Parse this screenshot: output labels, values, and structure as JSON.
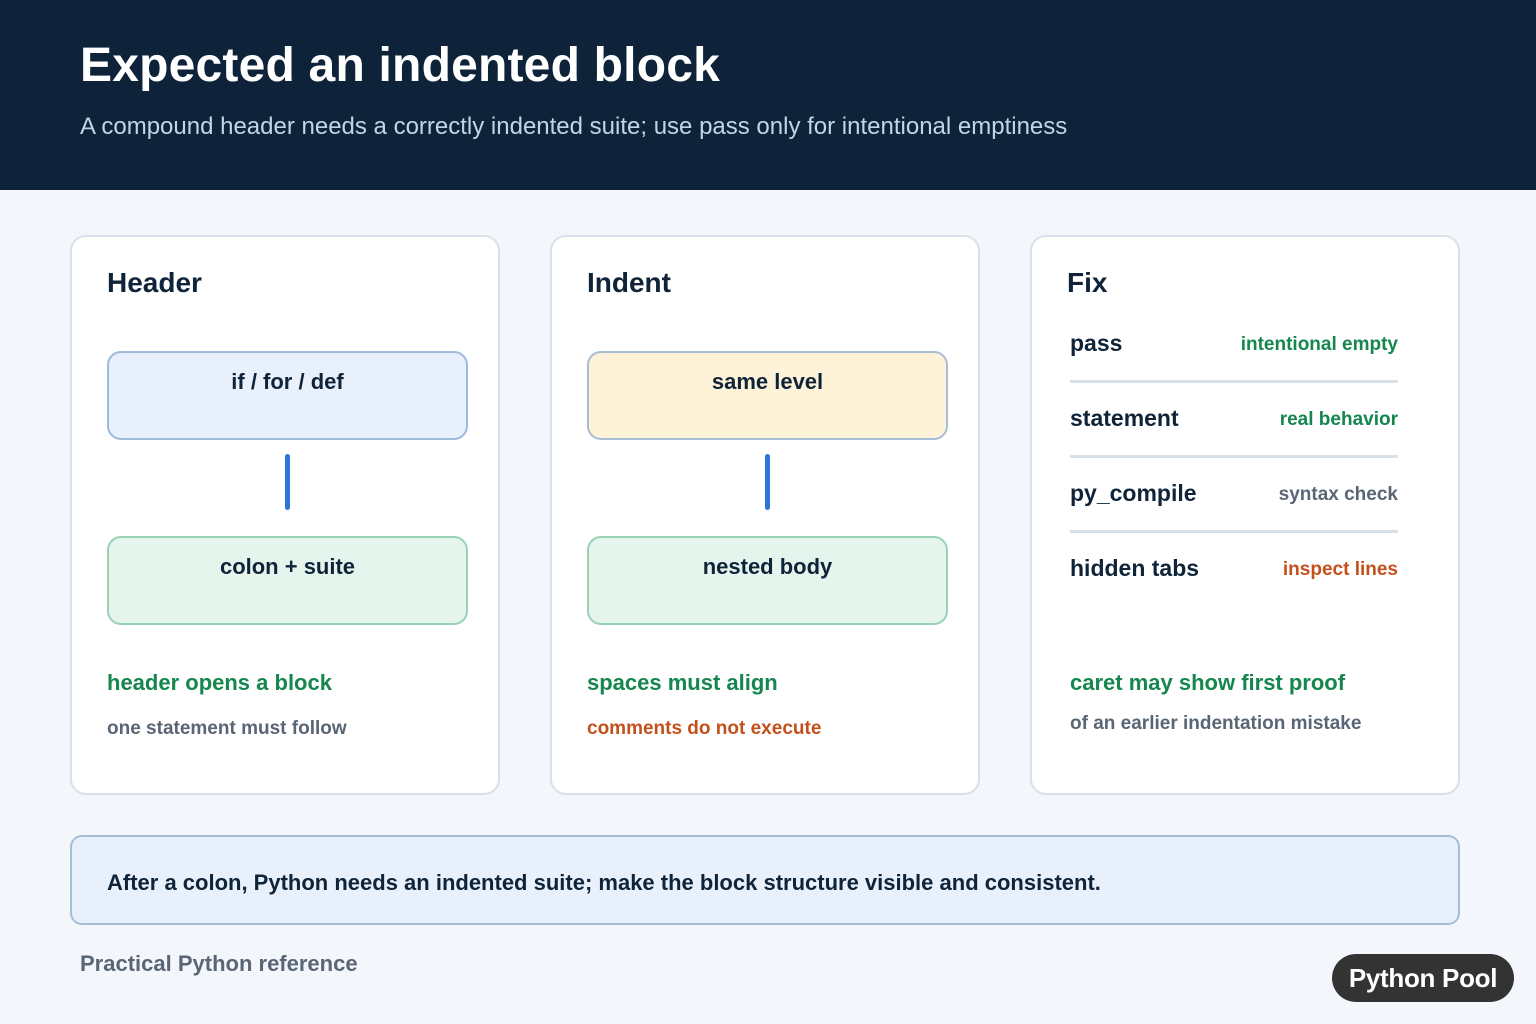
{
  "header": {
    "title": "Expected an indented block",
    "subtitle": "A compound header needs a correctly indented suite; use pass only for intentional emptiness"
  },
  "cards": {
    "header": {
      "title": "Header",
      "top_node": "if / for / def",
      "bottom_node": "colon + suite",
      "note_main": "header opens a block",
      "note_sub": "one statement must follow"
    },
    "indent": {
      "title": "Indent",
      "top_node": "same level",
      "bottom_node": "nested body",
      "note_main": "spaces must align",
      "note_sub": "comments do not execute"
    },
    "fix": {
      "title": "Fix",
      "rows": [
        {
          "key": "pass",
          "value": "intentional empty"
        },
        {
          "key": "statement",
          "value": "real behavior"
        },
        {
          "key": "py_compile",
          "value": "syntax check"
        },
        {
          "key": "hidden tabs",
          "value": "inspect lines"
        }
      ],
      "note_main": "caret may show first proof",
      "note_sub": "of an earlier indentation mistake"
    }
  },
  "callout": {
    "text": "After a colon, Python needs an indented suite; make the block structure visible and consistent."
  },
  "footer": {
    "text": "Practical Python reference",
    "brand": "Python Pool"
  },
  "colors": {
    "header_bg": "#0e233a",
    "accent_blue": "#2f74dd",
    "green": "#16864f",
    "orange": "#c4501c",
    "gray": "#5a6675"
  }
}
